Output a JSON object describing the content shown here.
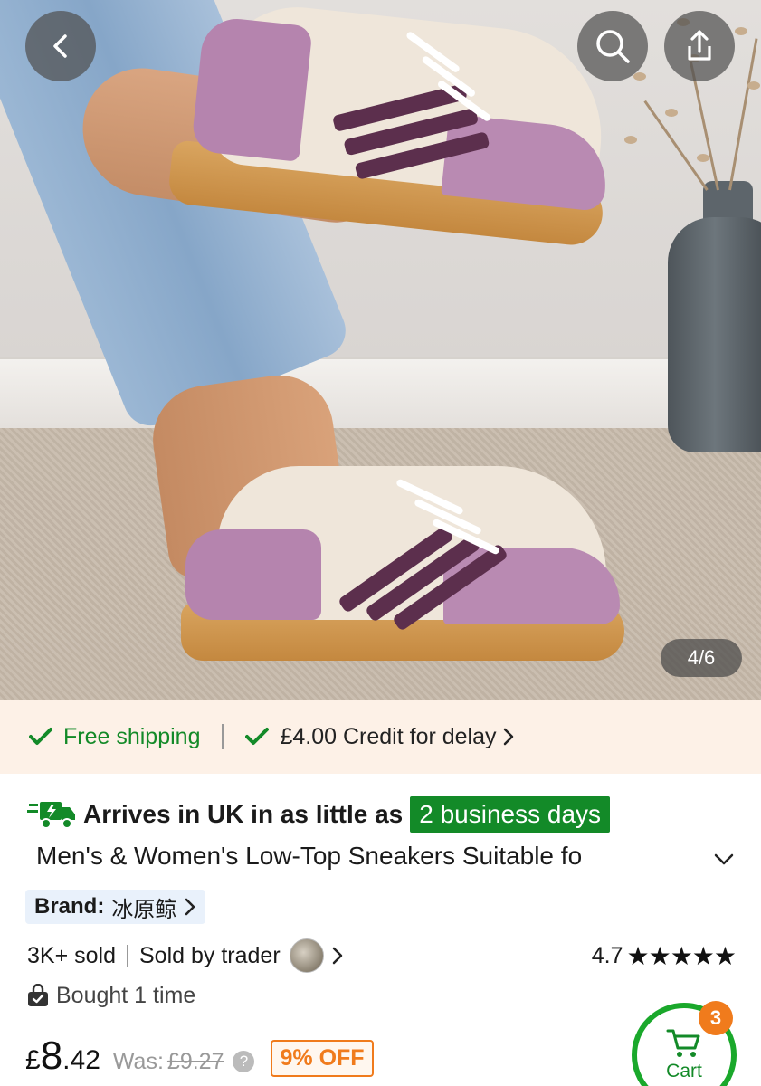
{
  "gallery": {
    "counter": "4/6",
    "back_icon": "chevron-left-icon",
    "search_icon": "search-icon",
    "share_icon": "share-icon"
  },
  "shipping": {
    "free_label": "Free shipping",
    "credit_label": "£4.00 Credit for delay",
    "accent": "#138a28"
  },
  "product": {
    "arrival_text": "Arrives in UK in as little as",
    "arrival_highlight": "2 business days",
    "title": "Men's & Women's Low-Top Sneakers Suitable fo",
    "brand_label": "Brand:",
    "brand_value": "冰原鲸",
    "sold_count": "3K+ sold",
    "seller_text": "Sold by trader",
    "rating": "4.7",
    "stars": "★★★★★",
    "bought_text": "Bought 1 time"
  },
  "price": {
    "currency": "£",
    "integer": "8",
    "decimal": ".42",
    "was_label": "Was:",
    "was_value": "£9.27",
    "info": "?",
    "discount": "9% OFF",
    "discount_color": "#f07b1c"
  },
  "cart": {
    "label": "Cart",
    "badge": "3"
  }
}
